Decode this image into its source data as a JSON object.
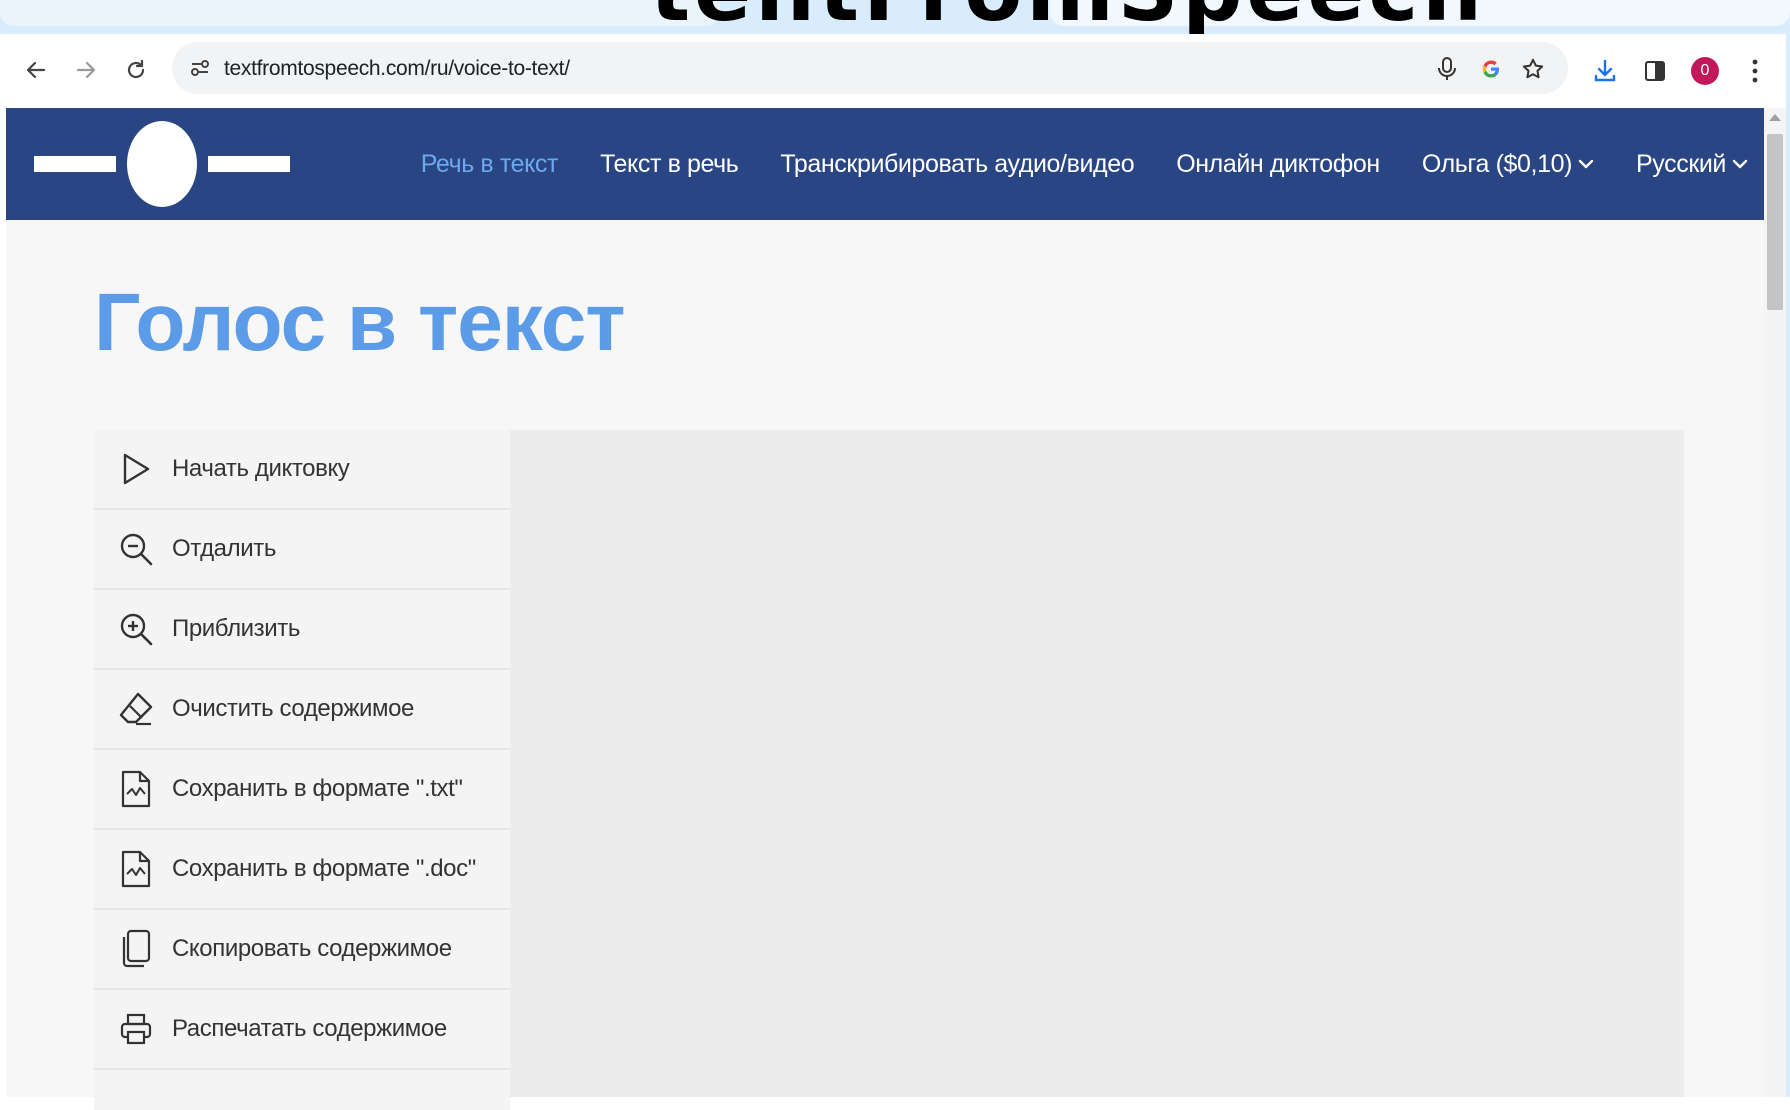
{
  "banner": {
    "text": "tentFromSpeech"
  },
  "browser": {
    "url": "textfromtospeech.com/ru/voice-to-text/",
    "icons": {
      "back": "back-arrow-icon",
      "forward": "forward-arrow-icon",
      "reload": "reload-icon",
      "site_info": "site-settings-icon",
      "mic": "microphone-icon",
      "google": "google-icon",
      "bookmark": "star-icon",
      "download": "download-icon",
      "side_panel": "side-panel-icon",
      "menu": "kebab-menu-icon"
    },
    "profile_badge": "0",
    "colors": {
      "download_accent": "#1a73e8",
      "profile": "#c2185b"
    }
  },
  "header": {
    "background": "#2a4583",
    "nav": [
      {
        "label": "Речь в текст",
        "active": true
      },
      {
        "label": "Текст в речь",
        "active": false
      },
      {
        "label": "Транскрибировать аудио/видео",
        "active": false
      },
      {
        "label": "Онлайн диктофон",
        "active": false
      },
      {
        "label": "Ольга ($0,10)",
        "active": false,
        "dropdown": true
      },
      {
        "label": "Русский",
        "active": false,
        "dropdown": true
      }
    ],
    "active_color": "#6aa9ee"
  },
  "page": {
    "title": "Голос в текст",
    "title_color": "#5b9be8"
  },
  "menu": {
    "items": [
      {
        "label": "Начать диктовку",
        "icon": "play-icon"
      },
      {
        "label": "Отдалить",
        "icon": "zoom-out-icon"
      },
      {
        "label": "Приблизить",
        "icon": "zoom-in-icon"
      },
      {
        "label": "Очистить содержимое",
        "icon": "eraser-icon"
      },
      {
        "label": "Сохранить в формате \".txt\"",
        "icon": "file-txt-icon"
      },
      {
        "label": "Сохранить в формате \".doc\"",
        "icon": "file-doc-icon"
      },
      {
        "label": "Скопировать содержимое",
        "icon": "copy-icon"
      },
      {
        "label": "Распечатать содержимое",
        "icon": "printer-icon"
      }
    ]
  }
}
